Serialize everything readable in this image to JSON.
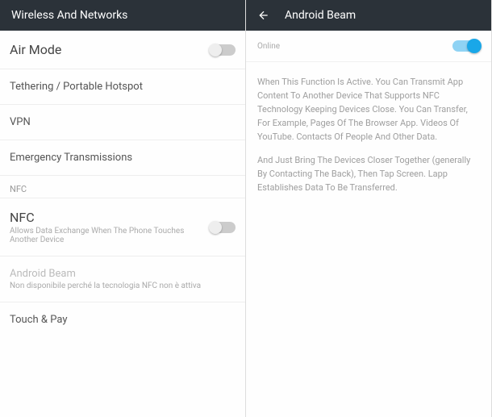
{
  "left": {
    "title": "Wireless And Networks",
    "airMode": {
      "label": "Air Mode",
      "on": false
    },
    "tethering": {
      "label": "Tethering / Portable Hotspot"
    },
    "vpn": {
      "label": "VPN"
    },
    "emergency": {
      "label": "Emergency Transmissions"
    },
    "nfcSection": {
      "label": "NFC"
    },
    "nfc": {
      "label": "NFC",
      "sub": "Allows Data Exchange When The Phone Touches Another Device",
      "on": false
    },
    "androidBeam": {
      "label": "Android Beam",
      "sub": "Non disponibile perché la tecnologia NFC non è attiva"
    },
    "touchPay": {
      "label": "Touch & Pay"
    }
  },
  "right": {
    "title": "Android Beam",
    "toggleLabel": "Online",
    "toggleOn": true,
    "para1": "When This Function Is Active. You Can Transmit App Content To Another Device That Supports NFC Technology Keeping Devices Close. You Can Transfer, For Example, Pages Of The Browser App. Videos Of YouTube. Contacts Of People And Other Data.",
    "para2": "And Just Bring The Devices Closer Together (generally By Contacting The Back), Then Tap Screen. Lapp Establishes Data To Be Transferred."
  }
}
